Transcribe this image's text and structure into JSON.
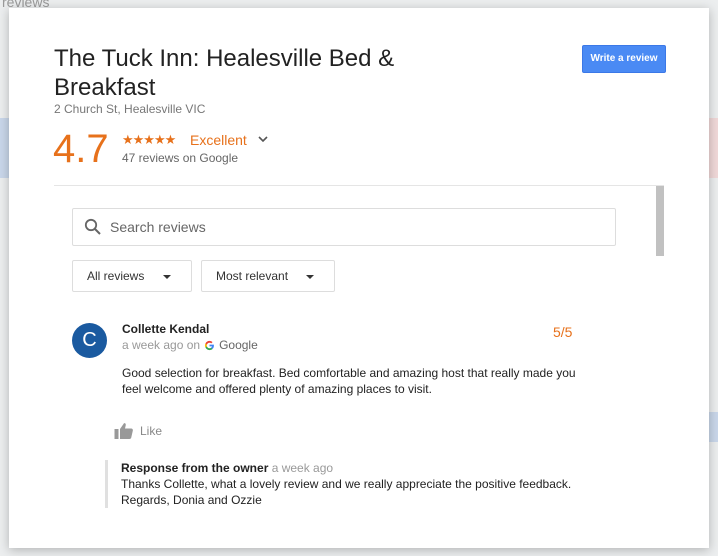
{
  "background": {
    "tab_text": "reviews"
  },
  "header": {
    "title": "The Tuck Inn: Healesville Bed & Breakfast",
    "address": "2 Church St, Healesville VIC",
    "write_review_label": "Write a review"
  },
  "summary": {
    "rating": "4.7",
    "stars": "★★★★★",
    "rating_label": "Excellent",
    "review_count": "47 reviews on Google"
  },
  "search": {
    "placeholder": "Search reviews"
  },
  "filters": {
    "filter_value": "All reviews",
    "sort_value": "Most relevant"
  },
  "review": {
    "avatar_letter": "C",
    "reviewer": "Collette Kendal",
    "time": "a week ago on",
    "source": "Google",
    "score": "5/5",
    "text": "Good selection for breakfast. Bed comfortable and amazing host that really made you feel welcome and offered plenty of amazing places to visit.",
    "like_label": "Like",
    "response": {
      "heading": "Response from the owner",
      "time": "a week ago",
      "text": "Thanks Collette, what a lovely review and we really appreciate the positive feedback. Regards, Donia and Ozzie"
    }
  },
  "colors": {
    "accent_orange": "#e7711b",
    "button_blue": "#4a8af4",
    "avatar_blue": "#1a5aa0"
  },
  "icons": [
    "search-icon",
    "chevron-down-icon",
    "caret-down-icon",
    "google-g-icon",
    "thumbs-up-icon"
  ]
}
